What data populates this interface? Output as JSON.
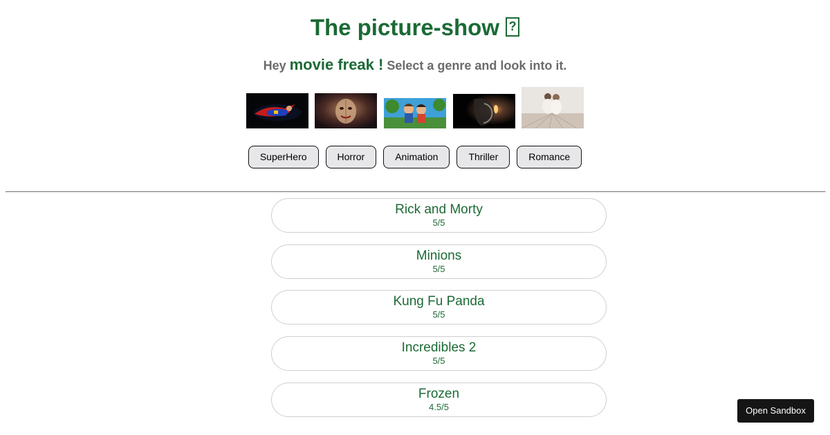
{
  "header": {
    "title": "The picture-show",
    "title_glyph": "?",
    "tagline_prefix": "Hey ",
    "tagline_highlight": "movie freak !",
    "tagline_suffix": " Select a genre and look into it."
  },
  "thumbnails": [
    {
      "name": "superhero-thumbnail",
      "icon": "flying-hero-image"
    },
    {
      "name": "horror-thumbnail",
      "icon": "clown-image"
    },
    {
      "name": "animation-thumbnail",
      "icon": "cartoon-kids-image"
    },
    {
      "name": "thriller-thumbnail",
      "icon": "dark-face-image"
    },
    {
      "name": "romance-thumbnail",
      "icon": "couple-image"
    }
  ],
  "genres": [
    "SuperHero",
    "Horror",
    "Animation",
    "Thriller",
    "Romance"
  ],
  "movies": [
    {
      "title": "Rick and Morty",
      "rating": "5/5"
    },
    {
      "title": "Minions",
      "rating": "5/5"
    },
    {
      "title": "Kung Fu Panda",
      "rating": "5/5"
    },
    {
      "title": "Incredibles 2",
      "rating": "5/5"
    },
    {
      "title": "Frozen",
      "rating": "4.5/5"
    }
  ],
  "sandbox_button": "Open Sandbox",
  "colors": {
    "accent_green": "#1b6a35",
    "muted_text": "#6b6b6b",
    "button_bg": "#e7e7ea",
    "sandbox_bg": "#151515"
  }
}
